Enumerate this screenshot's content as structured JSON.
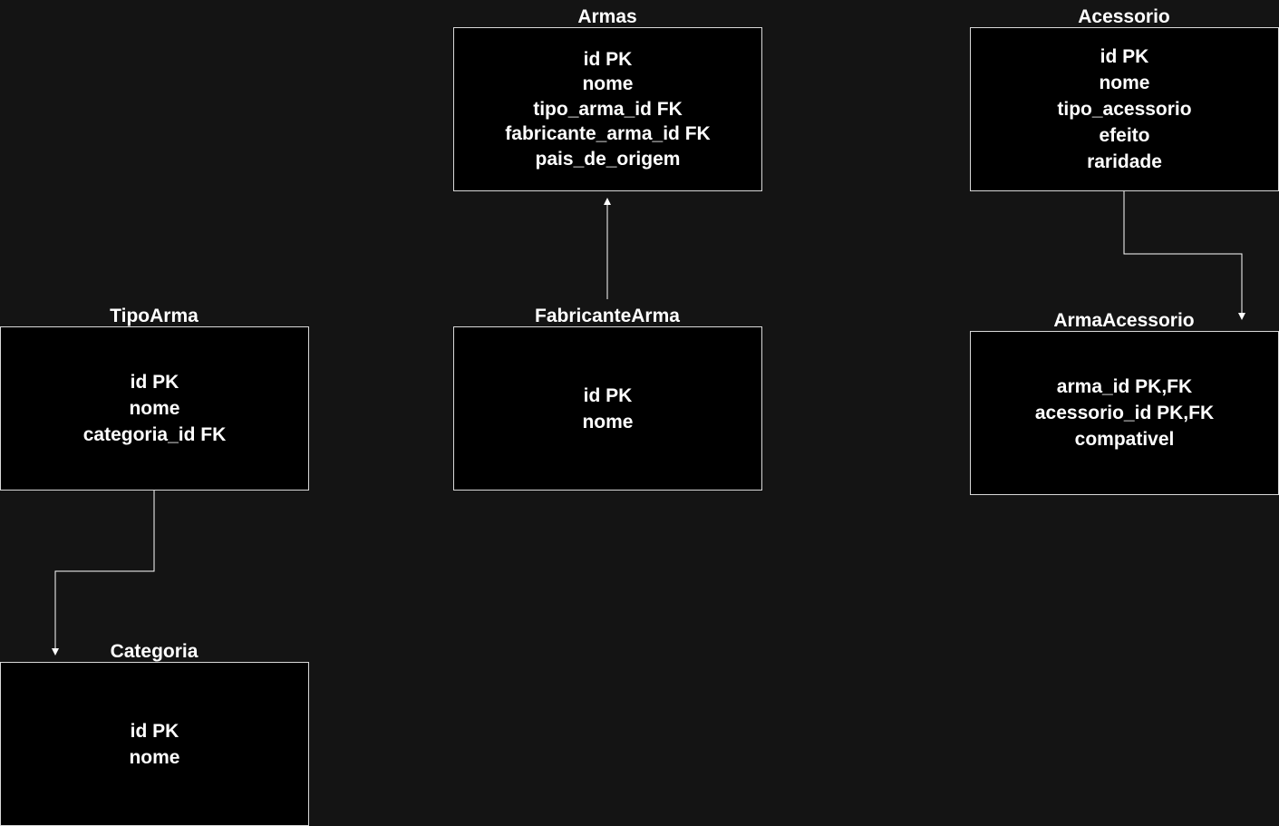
{
  "entities": {
    "armas": {
      "title": "Armas",
      "fields": [
        "id PK",
        "nome",
        "tipo_arma_id FK",
        "fabricante_arma_id FK",
        "pais_de_origem"
      ]
    },
    "acessorio": {
      "title": "Acessorio",
      "fields": [
        "id PK",
        "nome",
        "tipo_acessorio",
        "efeito",
        "raridade"
      ]
    },
    "tipo_arma": {
      "title": "TipoArma",
      "fields": [
        "id PK",
        "nome",
        "categoria_id FK"
      ]
    },
    "fabricante_arma": {
      "title": "FabricanteArma",
      "fields": [
        "id PK",
        "nome"
      ]
    },
    "arma_acessorio": {
      "title": "ArmaAcessorio",
      "fields": [
        "arma_id PK,FK",
        "acessorio_id PK,FK",
        "compativel"
      ]
    },
    "categoria": {
      "title": "Categoria",
      "fields": [
        "id PK",
        "nome"
      ]
    }
  },
  "colors": {
    "background": "#141414",
    "box_fill": "#000000",
    "box_border": "#d9d9d9",
    "text": "#ffffff",
    "connector": "#ffffff"
  }
}
